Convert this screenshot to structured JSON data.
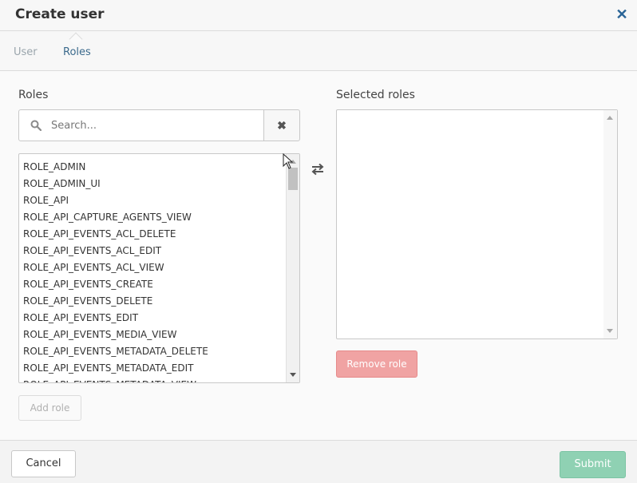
{
  "modal": {
    "title": "Create user",
    "close_icon": "close-icon"
  },
  "tabs": [
    {
      "label": "User",
      "active": false
    },
    {
      "label": "Roles",
      "active": true
    }
  ],
  "roles_panel": {
    "label": "Roles",
    "search_placeholder": "Search...",
    "clear_icon": "clear-search-icon",
    "items": [
      "ROLE_ADMIN",
      "ROLE_ADMIN_UI",
      "ROLE_API",
      "ROLE_API_CAPTURE_AGENTS_VIEW",
      "ROLE_API_EVENTS_ACL_DELETE",
      "ROLE_API_EVENTS_ACL_EDIT",
      "ROLE_API_EVENTS_ACL_VIEW",
      "ROLE_API_EVENTS_CREATE",
      "ROLE_API_EVENTS_DELETE",
      "ROLE_API_EVENTS_EDIT",
      "ROLE_API_EVENTS_MEDIA_VIEW",
      "ROLE_API_EVENTS_METADATA_DELETE",
      "ROLE_API_EVENTS_METADATA_EDIT",
      "ROLE_API_EVENTS_METADATA_VIEW"
    ],
    "add_button": "Add role"
  },
  "selected_panel": {
    "label": "Selected roles",
    "items": [],
    "remove_button": "Remove role"
  },
  "footer": {
    "cancel_label": "Cancel",
    "submit_label": "Submit"
  },
  "colors": {
    "accent": "#3b6a8c",
    "remove": "#f0a3a3",
    "submit": "#8fd1b3"
  }
}
